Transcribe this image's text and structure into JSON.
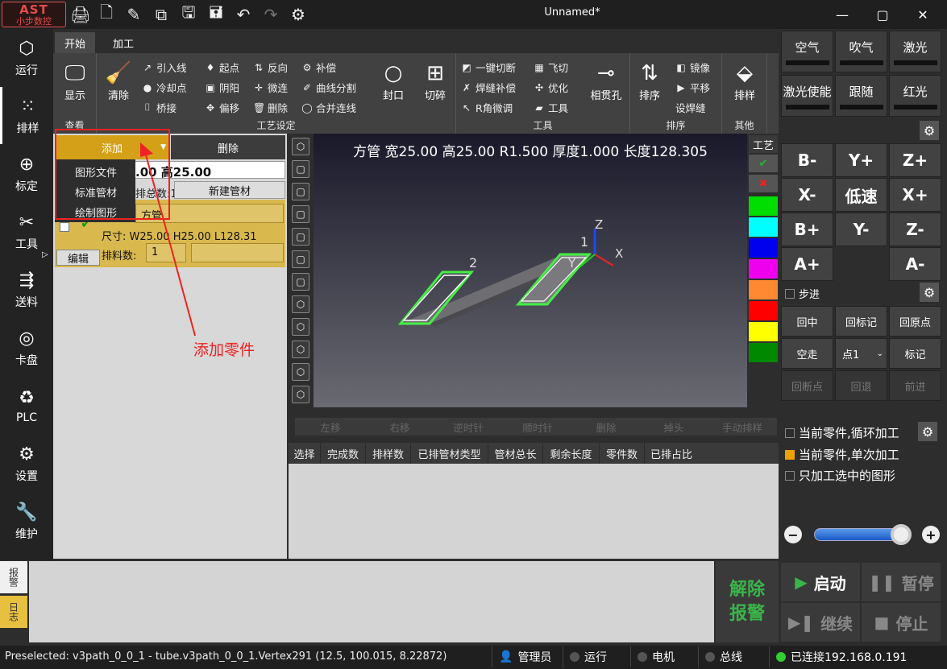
{
  "app": {
    "logo_top": "AST",
    "logo_bottom": "小步数控",
    "title": "Unnamed*"
  },
  "leftnav": [
    {
      "label": "运行",
      "icon": "cube-icon"
    },
    {
      "label": "排样",
      "icon": "grid-dots-icon"
    },
    {
      "label": "标定",
      "icon": "crosshair-icon"
    },
    {
      "label": "工具",
      "icon": "wrench-icon"
    },
    {
      "label": "送料",
      "icon": "feed-icon"
    },
    {
      "label": "卡盘",
      "icon": "chuck-icon"
    },
    {
      "label": "PLC",
      "icon": "recycle-icon"
    },
    {
      "label": "设置",
      "icon": "gear-icon"
    },
    {
      "label": "维护",
      "icon": "spanner-icon"
    }
  ],
  "tabs": {
    "start": "开始",
    "process": "加工"
  },
  "ribbon": {
    "view_group": "查看",
    "display": "显示",
    "process_group": "工艺设定",
    "clear": "清除",
    "lead_line": "引入线",
    "cool_point": "冷却点",
    "bridge": "桥接",
    "start_point": "起点",
    "yin_yang": "阴阳",
    "offset": "偏移",
    "reverse": "反向",
    "micro_join": "微连",
    "delete": "删除",
    "compensate": "补偿",
    "curve_split": "曲线分割",
    "merge_lines": "合并连线",
    "seal": "封口",
    "cut_set": "切碎",
    "tools_group": "工具",
    "one_key_cut": "一键切断",
    "weld_comp": "焊缝补偿",
    "r_corner": "R角微调",
    "fly_cut": "飞切",
    "optimize": "优化",
    "tools": "工具",
    "intersect_hole": "相贯孔",
    "nest_group": "排序",
    "sort": "排序",
    "mirror": "镜像",
    "translate": "平移",
    "set_weld": "设焊缝",
    "other_group": "其他",
    "nesting": "排样"
  },
  "partpanel": {
    "add": "添加",
    "delete": "删除",
    "menu": [
      "图形文件",
      "标准管材",
      "绘制图形"
    ],
    "size_header": ".00 高25.00",
    "total_label": "排总数:1",
    "new_tube": "新建管材",
    "shape": "方管",
    "size": "尺寸: W25.00 H25.00 L128.31",
    "count_label": "排料数:",
    "count": "1",
    "edit": "编辑"
  },
  "annotation": "添加零件",
  "viewport": {
    "info": "方管 宽25.00 高25.00 R1.500 厚度1.000 长度128.305",
    "label1": "1",
    "label2": "2",
    "axis_x": "X",
    "axis_y": "Y",
    "axis_z": "Z"
  },
  "process_label": "工艺",
  "swatches": [
    "#00dd00",
    "#00ffff",
    "#0000ee",
    "#ee00ee",
    "#ff8833",
    "#ff0000",
    "#ffff00",
    "#008800"
  ],
  "actions": [
    "左移",
    "右移",
    "逆时针",
    "顺时针",
    "删除",
    "掉头",
    "手动排样"
  ],
  "table_headers": [
    "选择",
    "完成数",
    "排样数",
    "已排管材类型",
    "管材总长",
    "剩余长度",
    "零件数",
    "已排占比"
  ],
  "right": {
    "gas": [
      "空气",
      "吹气",
      "激光",
      "激光使能",
      "跟随",
      "红光"
    ],
    "jog": [
      "B-",
      "Y+",
      "Z+",
      "X-",
      "低速",
      "X+",
      "B+",
      "Y-",
      "Z-",
      "A+",
      "",
      "A-"
    ],
    "step": "步进",
    "func": [
      "回中",
      "回标记",
      "回原点",
      "空走",
      "点1",
      "标记",
      "回断点",
      "回退",
      "前进"
    ],
    "opt_loop": "当前零件,循环加工",
    "opt_single": "当前零件,单次加工",
    "opt_selected": "只加工选中的图形",
    "minus": "−",
    "plus": "+"
  },
  "bottom": {
    "alarm_tab": "报警",
    "log_tab": "日志",
    "clear_alarm": [
      "解除",
      "报警"
    ],
    "start": "启动",
    "pause": "暂停",
    "resume": "继续",
    "stop": "停止"
  },
  "status": {
    "text": "Preselected: v3path_0_0_1 - tube.v3path_0_0_1.Vertex291 (12.5, 100.015, 8.22872)",
    "admin": "管理员",
    "run": "运行",
    "motor": "电机",
    "bus": "总线",
    "connected": "已连接192.168.0.191"
  },
  "colors": {
    "accent": "#d4a017",
    "annotation": "#ee2222",
    "ok": "#33cc33"
  }
}
